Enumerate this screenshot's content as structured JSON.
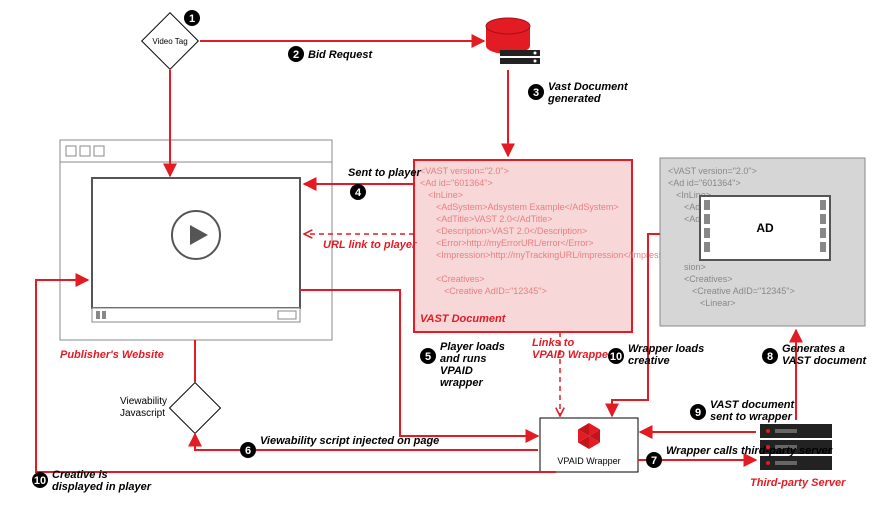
{
  "steps": {
    "s1": {
      "num": "1",
      "label": "Video Tag"
    },
    "s2": {
      "num": "2",
      "label": "Bid Request"
    },
    "s3": {
      "num": "3",
      "label": "Vast Document generated"
    },
    "s4": {
      "num": "4",
      "label": "Sent to player"
    },
    "s5": {
      "num": "5",
      "label": "Player loads and runs VPAID wrapper"
    },
    "s6": {
      "num": "6",
      "label": "Viewability script injected on page"
    },
    "s7": {
      "num": "7",
      "label": "Wrapper calls third-party server"
    },
    "s8": {
      "num": "8",
      "label": "Generates a VAST document"
    },
    "s9": {
      "num": "9",
      "label": "VAST document sent to wrapper"
    },
    "s10a": {
      "num": "10",
      "label": "Wrapper loads creative"
    },
    "s10b": {
      "num": "10",
      "label": "Creative is displayed in player"
    }
  },
  "labels": {
    "publisher": "Publisher's Website",
    "viewability": "Viewability Javascript",
    "vast_doc": "VAST Document",
    "url_link": "URL link to player",
    "links_vpaid": "Links to VPAID Wrapper",
    "vpaid": "VPAID Wrapper",
    "third_party": "Third-party Server",
    "ad": "AD"
  },
  "vast_code": {
    "l1": "<VAST version=\"2.0\">",
    "l2": "<Ad id=\"601364\">",
    "l3": "<InLine>",
    "l4": "<AdSystem>Adsystem Example</AdSystem>",
    "l5": "<AdTitle>VAST 2.0</AdTitle>",
    "l6": "<Description>VAST 2.0</Description>",
    "l7": "<Error>http://myErrorURL/error</Error>",
    "l8": "<Impression>http://myTrackingURL/impression</Impression>",
    "l9": "<Creatives>",
    "l10": "<Creative AdID=\"12345\">",
    "l11": "<Linear>"
  },
  "colors": {
    "accent": "#e31b23",
    "vast_bg": "#f7d7d7",
    "grey_bg": "#d6d6d6"
  }
}
